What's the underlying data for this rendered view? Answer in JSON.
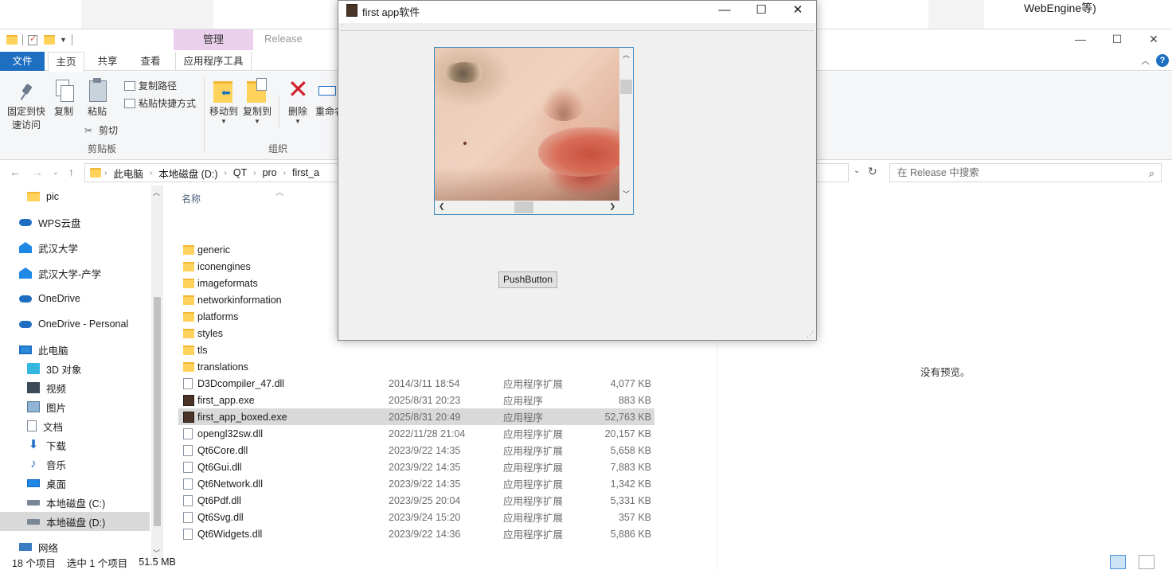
{
  "background": {
    "partial_text": "WebEngine等)"
  },
  "explorer": {
    "quick_access": {
      "context_tab": "管理",
      "context_title": "Release"
    },
    "window_controls": {
      "minimize": "—",
      "maximize": "☐",
      "close": "✕"
    },
    "ribbon_tabs": [
      "文件",
      "主页",
      "共享",
      "查看",
      "应用程序工具"
    ],
    "ribbon": {
      "pin_label_1": "固定到快",
      "pin_label_2": "速访问",
      "copy": "复制",
      "paste": "粘贴",
      "copy_path": "复制路径",
      "paste_shortcut": "粘贴快捷方式",
      "cut": "剪切",
      "group_clipboard": "剪贴板",
      "move_to": "移动到",
      "copy_to": "复制到",
      "delete": "删除",
      "rename": "重命名",
      "group_organize": "组织"
    },
    "address": {
      "crumbs": [
        "此电脑",
        "本地磁盘 (D:)",
        "QT",
        "pro",
        "first_a"
      ]
    },
    "search_placeholder": "在 Release 中搜索",
    "nav_items": [
      {
        "label": "pic",
        "icon": "folder-icon"
      },
      {
        "label": "WPS云盘",
        "icon": "cloud-icon"
      },
      {
        "label": "武汉大学",
        "icon": "building-icon"
      },
      {
        "label": "武汉大学-产学",
        "icon": "building-icon"
      },
      {
        "label": "OneDrive",
        "icon": "onedrive-icon"
      },
      {
        "label": "OneDrive - Personal",
        "icon": "onedrive-icon"
      },
      {
        "label": "此电脑",
        "icon": "pc-icon"
      },
      {
        "label": "3D 对象",
        "icon": "cube-icon"
      },
      {
        "label": "视频",
        "icon": "video-icon"
      },
      {
        "label": "图片",
        "icon": "picture-icon"
      },
      {
        "label": "文档",
        "icon": "document-icon"
      },
      {
        "label": "下载",
        "icon": "download-icon"
      },
      {
        "label": "音乐",
        "icon": "music-icon"
      },
      {
        "label": "桌面",
        "icon": "desktop-icon"
      },
      {
        "label": "本地磁盘 (C:)",
        "icon": "drive-icon"
      },
      {
        "label": "本地磁盘 (D:)",
        "icon": "drive-icon"
      },
      {
        "label": "网络",
        "icon": "network-icon"
      }
    ],
    "column_name": "名称",
    "files": [
      {
        "name": "generic",
        "date": "",
        "type": "",
        "size": "",
        "kind": "folder"
      },
      {
        "name": "iconengines",
        "date": "",
        "type": "",
        "size": "",
        "kind": "folder"
      },
      {
        "name": "imageformats",
        "date": "",
        "type": "",
        "size": "",
        "kind": "folder"
      },
      {
        "name": "networkinformation",
        "date": "",
        "type": "",
        "size": "",
        "kind": "folder"
      },
      {
        "name": "platforms",
        "date": "",
        "type": "",
        "size": "",
        "kind": "folder"
      },
      {
        "name": "styles",
        "date": "",
        "type": "",
        "size": "",
        "kind": "folder"
      },
      {
        "name": "tls",
        "date": "",
        "type": "",
        "size": "",
        "kind": "folder"
      },
      {
        "name": "translations",
        "date": "",
        "type": "",
        "size": "",
        "kind": "folder"
      },
      {
        "name": "D3Dcompiler_47.dll",
        "date": "2014/3/11 18:54",
        "type": "应用程序扩展",
        "size": "4,077 KB",
        "kind": "dll"
      },
      {
        "name": "first_app.exe",
        "date": "2025/8/31 20:23",
        "type": "应用程序",
        "size": "883 KB",
        "kind": "exe"
      },
      {
        "name": "first_app_boxed.exe",
        "date": "2025/8/31 20:49",
        "type": "应用程序",
        "size": "52,763 KB",
        "kind": "exe"
      },
      {
        "name": "opengl32sw.dll",
        "date": "2022/11/28 21:04",
        "type": "应用程序扩展",
        "size": "20,157 KB",
        "kind": "dll"
      },
      {
        "name": "Qt6Core.dll",
        "date": "2023/9/22 14:35",
        "type": "应用程序扩展",
        "size": "5,658 KB",
        "kind": "dll"
      },
      {
        "name": "Qt6Gui.dll",
        "date": "2023/9/22 14:35",
        "type": "应用程序扩展",
        "size": "7,883 KB",
        "kind": "dll"
      },
      {
        "name": "Qt6Network.dll",
        "date": "2023/9/22 14:35",
        "type": "应用程序扩展",
        "size": "1,342 KB",
        "kind": "dll"
      },
      {
        "name": "Qt6Pdf.dll",
        "date": "2023/9/25 20:04",
        "type": "应用程序扩展",
        "size": "5,331 KB",
        "kind": "dll"
      },
      {
        "name": "Qt6Svg.dll",
        "date": "2023/9/24 15:20",
        "type": "应用程序扩展",
        "size": "357 KB",
        "kind": "dll"
      },
      {
        "name": "Qt6Widgets.dll",
        "date": "2023/9/22 14:36",
        "type": "应用程序扩展",
        "size": "5,886 KB",
        "kind": "dll"
      }
    ],
    "preview_text": "没有预览。",
    "status": {
      "count": "18 个项目",
      "selected": "选中 1 个项目",
      "size": "51.5 MB"
    }
  },
  "qt_app": {
    "title": "first app软件",
    "controls": {
      "minimize": "—",
      "maximize": "☐",
      "close": "✕"
    },
    "menubar_mark": "·",
    "push_button": "PushButton"
  }
}
